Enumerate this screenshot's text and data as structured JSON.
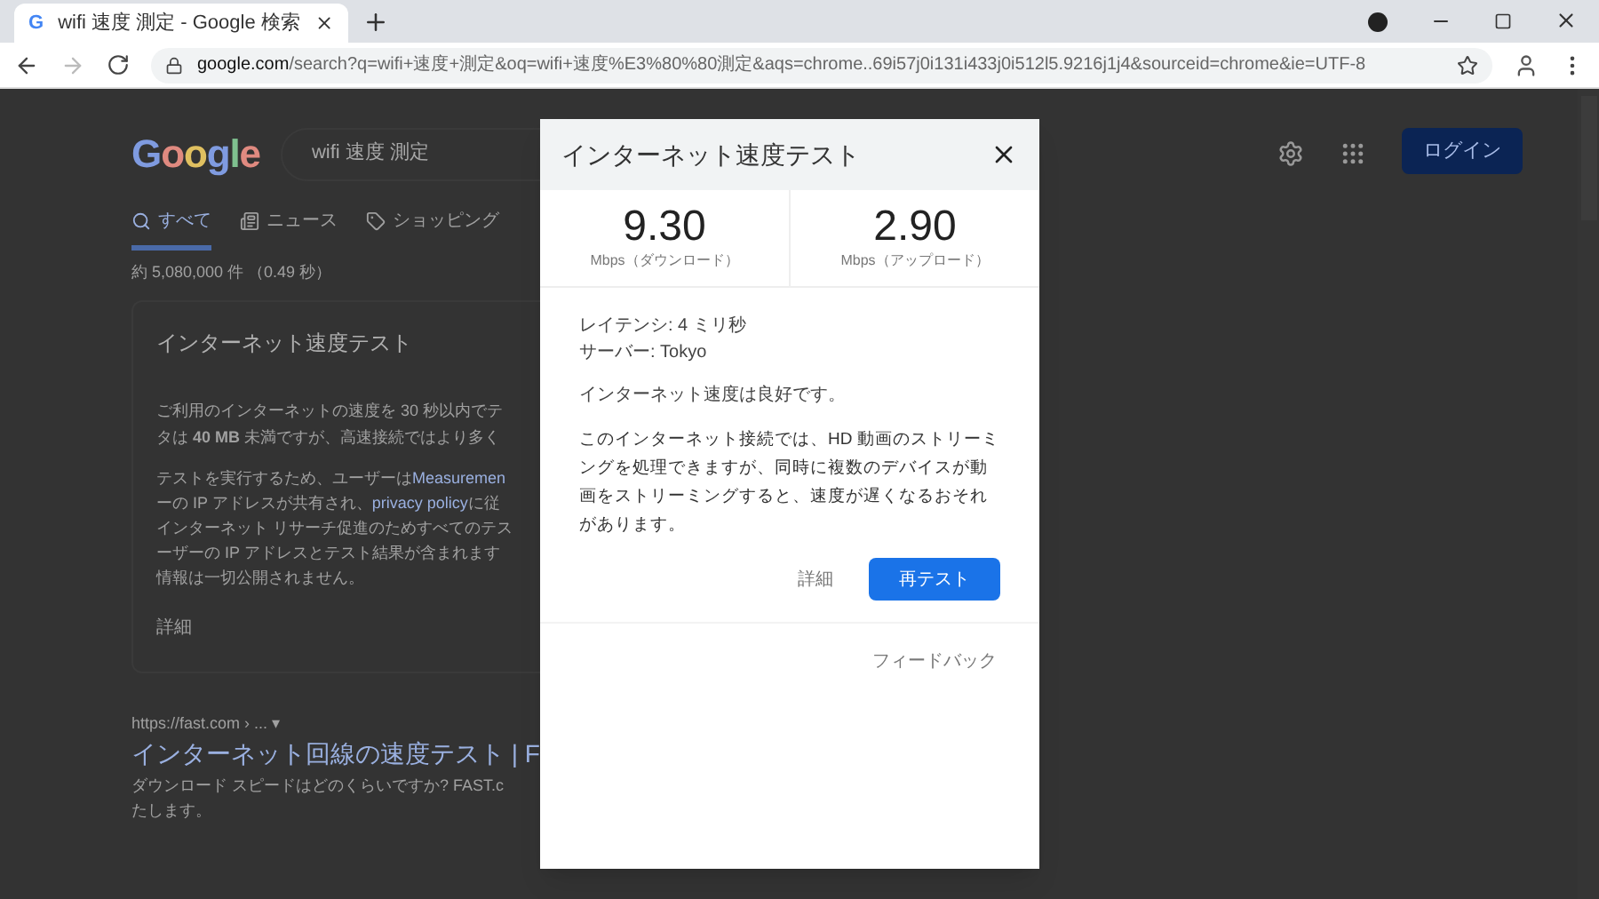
{
  "browser": {
    "favicon": "G",
    "tab_title": "wifi 速度 測定 - Google 検索",
    "url_host": "google.com",
    "url_path": "/search?q=wifi+速度+測定&oq=wifi+速度%E3%80%80測定&aqs=chrome..69i57j0i131i433j0i512l5.9216j1j4&sourceid=chrome&ie=UTF-8"
  },
  "page": {
    "logo": "Google",
    "search_query": "wifi 速度 測定",
    "login": "ログイン",
    "tabs": [
      {
        "label": "すべて",
        "selected": true,
        "kind": "search"
      },
      {
        "label": "ニュース",
        "selected": false,
        "kind": "news"
      },
      {
        "label": "ショッピング",
        "selected": false,
        "kind": "shopping"
      }
    ],
    "result_stats": "約 5,080,000 件 （0.49 秒）",
    "card": {
      "title": "インターネット速度テスト",
      "paragraph_1": [
        "ご利用のインターネットの速度を 30 秒以内でテ",
        "タは **40 MB** 未満ですが、高速接続ではより多く"
      ],
      "paragraph_2": [
        {
          "text": "テストを実行するため、ユーザーは ",
          "link": "Measuremen"
        },
        {
          "text": "ーの IP アドレスが共有され、",
          "link": "privacy policy",
          "after": "に従"
        },
        {
          "text": "インターネット リサーチ促進のためすべてのテス"
        },
        {
          "text": "ーザーの IP アドレスとテスト結果が含まれます"
        },
        {
          "text": "情報は一切公開されません。"
        }
      ],
      "details": "詳細"
    },
    "result": {
      "url": "https://fast.com › ... ▾",
      "title": "インターネット回線の速度テスト | F",
      "snippet": [
        "ダウンロード スピードはどのくらいですか? FAST.c",
        "たします。"
      ]
    }
  },
  "dialog": {
    "title": "インターネット速度テスト",
    "stats": [
      {
        "value": "9.30",
        "label": "Mbps（ダウンロード）"
      },
      {
        "value": "2.90",
        "label": "Mbps（アップロード）"
      }
    ],
    "latency": "レイテンシ: 4 ミリ秒",
    "server": "サーバー: Tokyo",
    "summary": "インターネット速度は良好です。",
    "description": "このインターネット接続では、HD 動画のストリーミングを処理できますが、同時に複数のデバイスが動画をストリーミングすると、速度が遅くなるおそれがあります。",
    "details": "詳細",
    "retest": "再テスト",
    "feedback": "フィードバック"
  }
}
